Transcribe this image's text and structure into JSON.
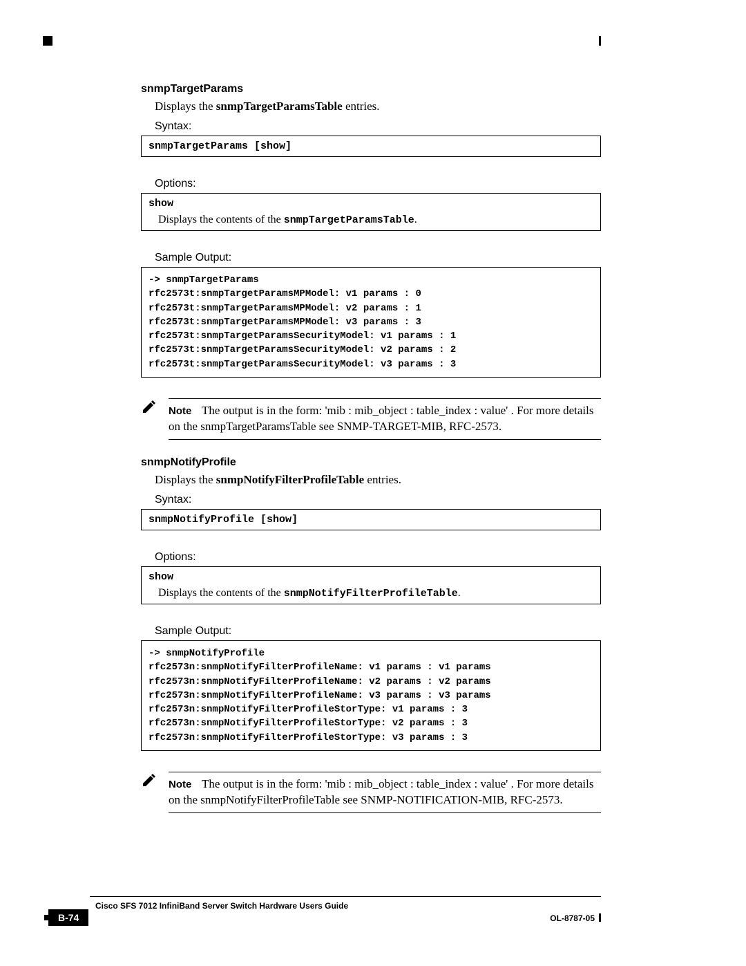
{
  "sections": [
    {
      "heading": "snmpTargetParams",
      "desc_pre": "Displays the ",
      "desc_bold": "snmpTargetParamsTable",
      "desc_post": " entries.",
      "syntax_label": "Syntax:",
      "syntax_cmd": "snmpTargetParams [show]",
      "options_label": "Options:",
      "option_name": "show",
      "option_desc_pre": "Displays the contents of the ",
      "option_desc_mono": "snmpTargetParamsTable",
      "option_desc_post": ".",
      "sample_label": "Sample Output:",
      "sample_lines": [
        "-> snmpTargetParams",
        "rfc2573t:snmpTargetParamsMPModel: v1 params : 0",
        "rfc2573t:snmpTargetParamsMPModel: v2 params : 1",
        "rfc2573t:snmpTargetParamsMPModel: v3 params : 3",
        "rfc2573t:snmpTargetParamsSecurityModel: v1 params : 1",
        "rfc2573t:snmpTargetParamsSecurityModel: v2 params : 2",
        "rfc2573t:snmpTargetParamsSecurityModel: v3 params : 3"
      ],
      "note_label": "Note",
      "note_text": "The output is in the form: 'mib : mib_object : table_index : value' . For more details on the snmpTargetParamsTable see SNMP-TARGET-MIB, RFC-2573."
    },
    {
      "heading": "snmpNotifyProfile",
      "desc_pre": "Displays the ",
      "desc_bold": "snmpNotifyFilterProfileTable",
      "desc_post": " entries.",
      "syntax_label": "Syntax:",
      "syntax_cmd": "snmpNotifyProfile [show]",
      "options_label": "Options:",
      "option_name": "show",
      "option_desc_pre": "Displays the contents of the ",
      "option_desc_mono": "snmpNotifyFilterProfileTable",
      "option_desc_post": ".",
      "sample_label": "Sample Output:",
      "sample_lines": [
        "-> snmpNotifyProfile",
        "rfc2573n:snmpNotifyFilterProfileName: v1 params : v1 params",
        "rfc2573n:snmpNotifyFilterProfileName: v2 params : v2 params",
        "rfc2573n:snmpNotifyFilterProfileName: v3 params : v3 params",
        "rfc2573n:snmpNotifyFilterProfileStorType: v1 params : 3",
        "rfc2573n:snmpNotifyFilterProfileStorType: v2 params : 3",
        "rfc2573n:snmpNotifyFilterProfileStorType: v3 params : 3"
      ],
      "note_label": "Note",
      "note_text": "The output is in the form: 'mib : mib_object : table_index : value' . For more details on the snmpNotifyFilterProfileTable see SNMP-NOTIFICATION-MIB, RFC-2573."
    }
  ],
  "footer": {
    "title": "Cisco SFS 7012 InfiniBand Server Switch Hardware Users Guide",
    "page_number": "B-74",
    "doc_id": "OL-8787-05"
  }
}
